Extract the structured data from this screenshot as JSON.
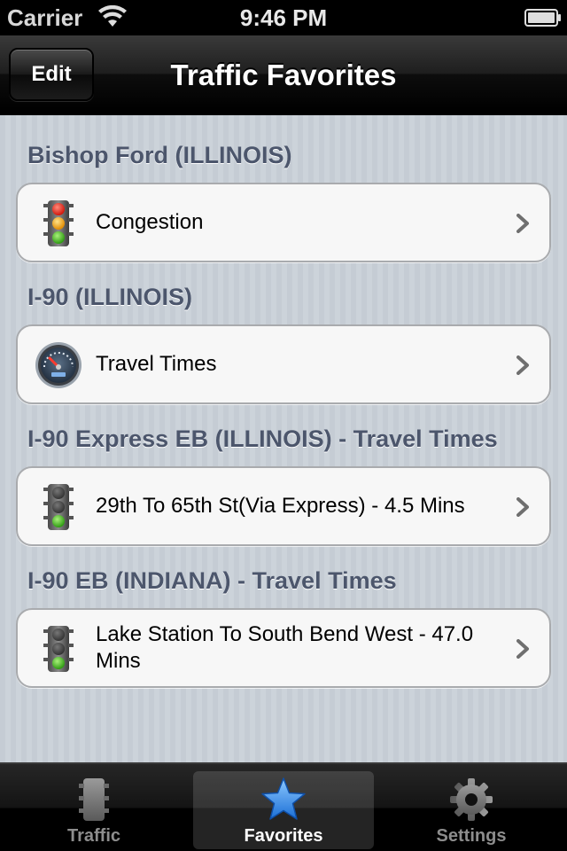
{
  "status_bar": {
    "carrier": "Carrier",
    "time": "9:46 PM",
    "wifi_icon": "wifi-icon",
    "battery_icon": "battery-icon"
  },
  "nav_bar": {
    "title": "Traffic Favorites",
    "edit_label": "Edit"
  },
  "sections": [
    {
      "header": "Bishop Ford (ILLINOIS)",
      "item": {
        "label": "Congestion",
        "icon": "traffic-light-icon",
        "lights": "all"
      }
    },
    {
      "header": "I-90 (ILLINOIS)",
      "item": {
        "label": "Travel Times",
        "icon": "speedometer-icon"
      }
    },
    {
      "header": "I-90 Express EB (ILLINOIS) - Travel Times",
      "item": {
        "label": "29th To 65th St(Via Express) - 4.5 Mins",
        "icon": "traffic-light-green-icon",
        "lights": "green"
      }
    },
    {
      "header": "I-90 EB (INDIANA) - Travel Times",
      "item": {
        "label": "Lake Station To South Bend West - 47.0 Mins",
        "icon": "traffic-light-green-icon",
        "lights": "green"
      }
    }
  ],
  "tab_bar": {
    "tabs": [
      {
        "label": "Traffic",
        "icon": "traffic-light-icon",
        "selected": false
      },
      {
        "label": "Favorites",
        "icon": "star-icon",
        "selected": true
      },
      {
        "label": "Settings",
        "icon": "gear-icon",
        "selected": false
      }
    ]
  },
  "colors": {
    "section_header": "#4c566c",
    "tab_selected": "#ffffff",
    "tab_unselected": "#8d8d8d",
    "star_blue": "#3b8fe6"
  }
}
